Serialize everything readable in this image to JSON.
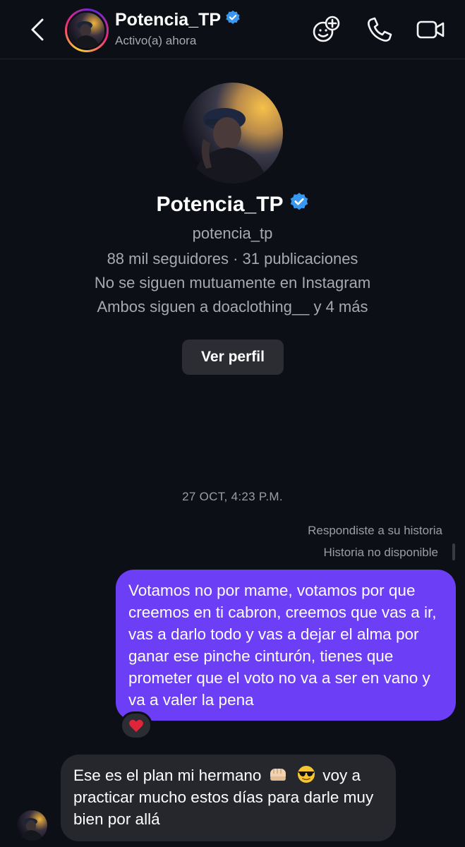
{
  "header": {
    "name": "Potencia_TP",
    "status": "Activo(a) ahora",
    "icons": [
      "back-chevron-icon",
      "effects-icon",
      "phone-icon",
      "video-camera-icon"
    ]
  },
  "profile": {
    "display_name": "Potencia_TP",
    "username": "potencia_tp",
    "stats": "88 mil seguidores · 31 publicaciones",
    "mutual_status": "No se siguen mutuamente en Instagram",
    "common_follows": "Ambos siguen a doaclothing__ y 4 más",
    "view_profile_label": "Ver perfil"
  },
  "thread": {
    "timestamp": "27 OCT, 4:23 P.M.",
    "reply_note": "Respondiste a su historia",
    "story_unavailable": "Historia no disponible",
    "messages": [
      {
        "from": "me",
        "text": "Votamos no por mame, votamos por que creemos en ti cabron, creemos que vas a ir, vas a darlo todo y vas a dejar el alma por ganar ese pinche cinturón, tienes que prometer que el voto no va a ser en vano y va a valer la pena",
        "reaction": "heart"
      },
      {
        "from": "them",
        "text_part1": "Ese es el plan mi hermano",
        "emojis": [
          "fist-bump",
          "sunglasses"
        ],
        "text_part2": "voy a practicar mucho estos días para darle muy bien por allá"
      }
    ]
  },
  "colors": {
    "background": "#0d0f17",
    "outgoing_bubble": "#6c3ef5",
    "incoming_bubble": "#26272d",
    "verified": "#3897f0",
    "muted_text": "#a8a9b0"
  }
}
